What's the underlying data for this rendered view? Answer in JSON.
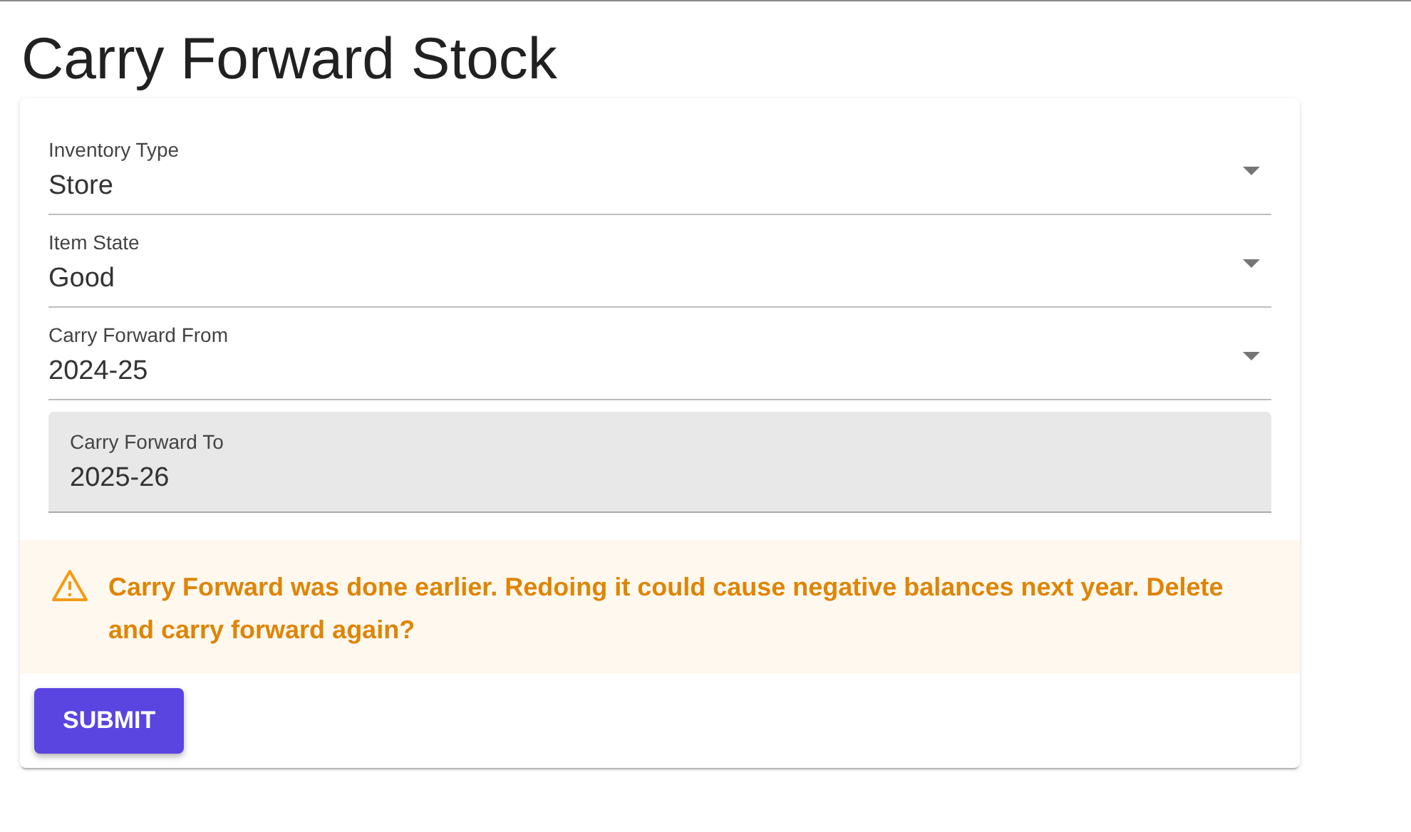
{
  "title": "Carry Forward Stock",
  "fields": [
    {
      "kind": "select",
      "label": "Inventory Type",
      "value": "Store"
    },
    {
      "kind": "select",
      "label": "Item State",
      "value": "Good"
    },
    {
      "kind": "select",
      "label": "Carry Forward From",
      "value": "2024-25"
    },
    {
      "kind": "readonly",
      "label": "Carry Forward To",
      "value": "2025-26"
    }
  ],
  "warning": {
    "text": "Carry Forward was done earlier. Redoing it could cause negative balances next year. Delete and carry forward again?"
  },
  "buttons": [
    {
      "label": "SUBMIT"
    }
  ]
}
